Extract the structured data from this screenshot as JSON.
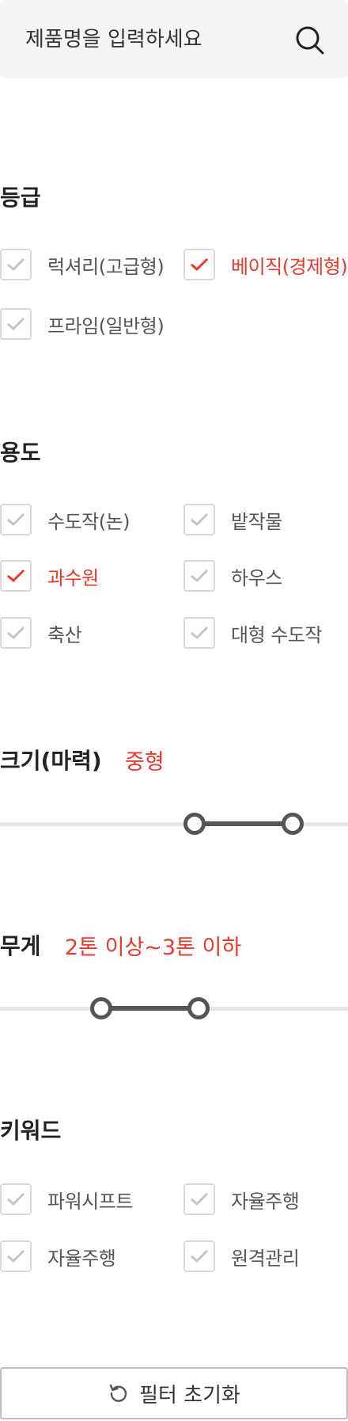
{
  "search": {
    "placeholder": "제품명을 입력하세요",
    "value": ""
  },
  "grade": {
    "title": "등급",
    "options": [
      {
        "label": "럭셔리(고급형)",
        "checked": false
      },
      {
        "label": "베이직(경제형)",
        "checked": true
      },
      {
        "label": "프라임(일반형)",
        "checked": false
      }
    ]
  },
  "usage": {
    "title": "용도",
    "options": [
      {
        "label": "수도작(논)",
        "checked": false
      },
      {
        "label": "밭작물",
        "checked": false
      },
      {
        "label": "과수원",
        "checked": true
      },
      {
        "label": "하우스",
        "checked": false
      },
      {
        "label": "축산",
        "checked": false
      },
      {
        "label": "대형 수도작",
        "checked": false
      }
    ]
  },
  "size": {
    "title": "크기(마력)",
    "value": "중형",
    "range": [
      0.56,
      0.84
    ]
  },
  "weight": {
    "title": "무게",
    "value": "2톤 이상~3톤 이하",
    "range": [
      0.29,
      0.57
    ]
  },
  "keyword": {
    "title": "키워드",
    "options": [
      {
        "label": "파워시프트",
        "checked": false
      },
      {
        "label": "자율주행",
        "checked": false
      },
      {
        "label": "자율주행",
        "checked": false
      },
      {
        "label": "원격관리",
        "checked": false
      }
    ]
  },
  "reset": {
    "label": "필터 초기화"
  },
  "colors": {
    "accent": "#e8392a",
    "unchecked": "#c4c4c4",
    "slider": "#555555"
  }
}
